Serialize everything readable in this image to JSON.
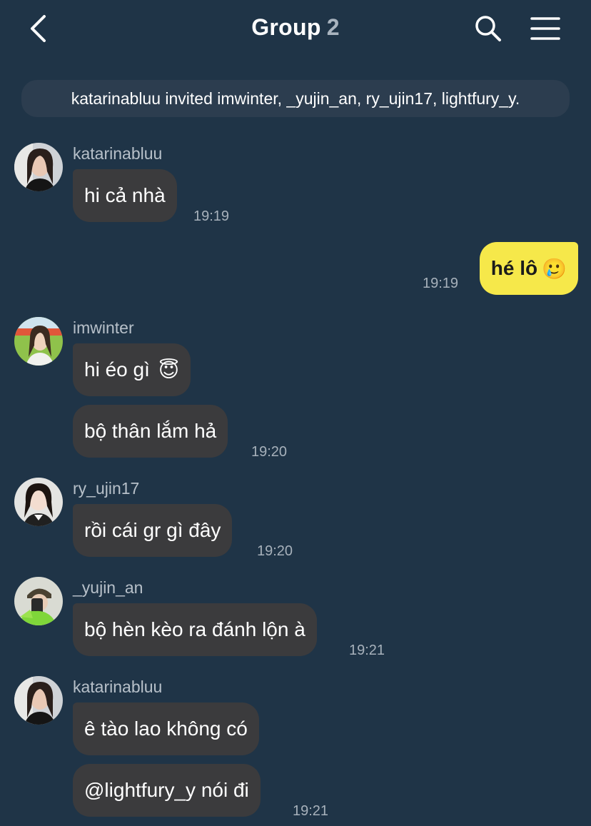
{
  "header": {
    "title": "Group",
    "count": "2",
    "icons": [
      "back-chevron-icon",
      "search-icon",
      "menu-icon"
    ]
  },
  "system_notice": "katarinabluu invited imwinter, _yujin_an, ry_ujin17, lightfury_y.",
  "messages": [
    {
      "sender": "katarinabluu",
      "text": "hi cả nhà",
      "time": "19:19"
    },
    {
      "sender": "me",
      "text": "hé lô",
      "emoji": "🥲",
      "time": "19:19"
    },
    {
      "sender": "imwinter",
      "text": "hi éo gì",
      "emoji": "😇"
    },
    {
      "sender": "imwinter",
      "text": "bộ thân lắm hả",
      "time": "19:20"
    },
    {
      "sender": "ry_ujin17",
      "text": "rồi cái gr gì đây",
      "time": "19:20"
    },
    {
      "sender": "_yujin_an",
      "text": "bộ hèn kèo ra đánh lộn à",
      "time": "19:21"
    },
    {
      "sender": "katarinabluu",
      "text": "ê tào lao không có"
    },
    {
      "sender": "katarinabluu",
      "text": "@lightfury_y nói đi",
      "time": "19:21"
    }
  ],
  "colors": {
    "background": "#1f3447",
    "incoming_bubble": "#3b3b3d",
    "outgoing_bubble": "#f6e84a",
    "notice_bg": "#2c3d4f"
  }
}
